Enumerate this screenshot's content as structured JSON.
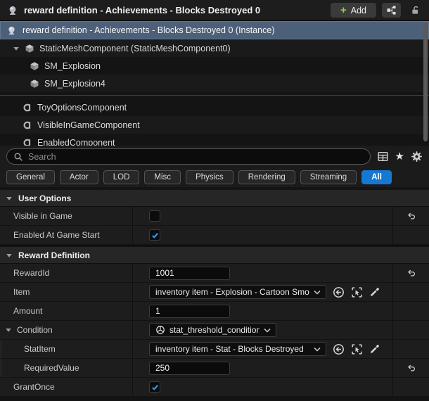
{
  "header": {
    "title": "reward definition - Achievements - Blocks Destroyed 0",
    "add_label": "Add"
  },
  "tree": {
    "selected_label": "reward definition - Achievements - Blocks Destroyed 0 (Instance)",
    "rows": [
      {
        "label": "StaticMeshComponent (StaticMeshComponent0)",
        "icon": "static-mesh-icon"
      },
      {
        "label": "SM_Explosion",
        "icon": "static-mesh-icon"
      },
      {
        "label": "SM_Explosion4",
        "icon": "static-mesh-icon"
      },
      {
        "label": "ToyOptionsComponent",
        "icon": "component-icon"
      },
      {
        "label": "VisibleInGameComponent",
        "icon": "component-icon"
      },
      {
        "label": "EnabledComponent",
        "icon": "component-icon"
      }
    ]
  },
  "search": {
    "placeholder": "Search"
  },
  "filters": {
    "items": [
      "General",
      "Actor",
      "LOD",
      "Misc",
      "Physics",
      "Rendering",
      "Streaming",
      "All"
    ],
    "active": "All"
  },
  "details": {
    "sections": {
      "user_options": "User Options",
      "reward_definition": "Reward Definition"
    },
    "rows": {
      "visible_in_game": {
        "label": "Visible in Game",
        "checked": false
      },
      "enabled_at_game_start": {
        "label": "Enabled At Game Start",
        "checked": true
      },
      "reward_id": {
        "label": "RewardId",
        "value": "1001"
      },
      "item": {
        "label": "Item",
        "value": "inventory item - Explosion - Cartoon Smoke"
      },
      "amount": {
        "label": "Amount",
        "value": "1"
      },
      "condition": {
        "label": "Condition",
        "value": "stat_threshold_condition"
      },
      "stat_item": {
        "label": "StatItem",
        "value": "inventory item - Stat - Blocks Destroyed"
      },
      "required_value": {
        "label": "RequiredValue",
        "value": "250"
      },
      "grant_once": {
        "label": "GrantOnce",
        "checked": true
      }
    }
  },
  "icons": [
    "actor-icon",
    "add-plus-icon",
    "hierarchy-icon",
    "unlock-icon",
    "static-mesh-icon",
    "component-icon",
    "caret-down-icon",
    "search-icon",
    "grid-view-icon",
    "star-icon",
    "gear-icon",
    "checkmark-icon",
    "chevron-down-icon",
    "sphere-icon",
    "use-selected-asset-icon",
    "pick-asset-icon",
    "eyedropper-icon",
    "reset-arrow-icon"
  ],
  "colors": {
    "accent_blue": "#1578d2",
    "check_blue": "#2b9fff",
    "add_green": "#8fd13f",
    "selection_slate": "#4c607a",
    "panel_bg": "#1d1d1d"
  }
}
